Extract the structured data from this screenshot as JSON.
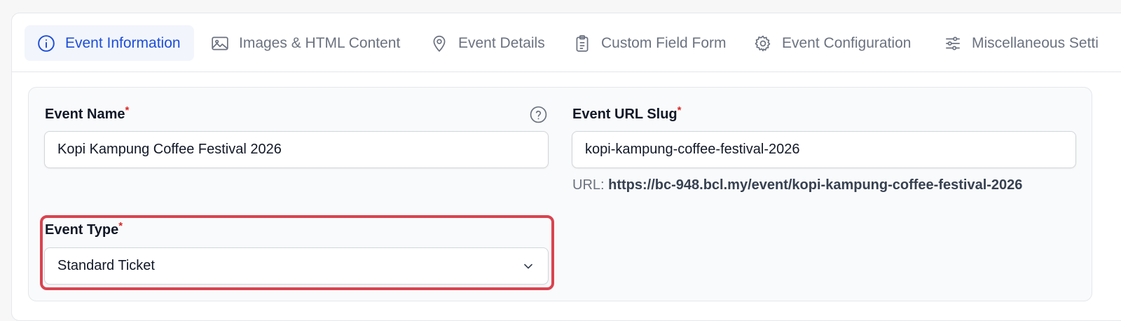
{
  "tabs": [
    {
      "label": "Event Information",
      "icon": "info-icon",
      "active": true
    },
    {
      "label": "Images & HTML Content",
      "icon": "image-icon"
    },
    {
      "label": "Event Details",
      "icon": "map-pin-icon"
    },
    {
      "label": "Custom Field Form",
      "icon": "clipboard-icon"
    },
    {
      "label": "Event Configuration",
      "icon": "gear-icon"
    },
    {
      "label": "Miscellaneous Setti",
      "icon": "sliders-icon"
    }
  ],
  "form": {
    "event_name": {
      "label": "Event Name",
      "required_mark": "*",
      "value": "Kopi Kampung Coffee Festival 2026"
    },
    "event_slug": {
      "label": "Event URL Slug",
      "required_mark": "*",
      "value": "kopi-kampung-coffee-festival-2026"
    },
    "url_prefix": "URL:",
    "url_value": "https://bc-948.bcl.my/event/kopi-kampung-coffee-festival-2026",
    "event_type": {
      "label": "Event Type",
      "required_mark": "*",
      "value": "Standard Ticket"
    }
  },
  "colors": {
    "accent": "#1d4ed8",
    "active_tab_bg": "#f2f5fc",
    "required": "#dc2626",
    "highlight": "#d9434f"
  }
}
